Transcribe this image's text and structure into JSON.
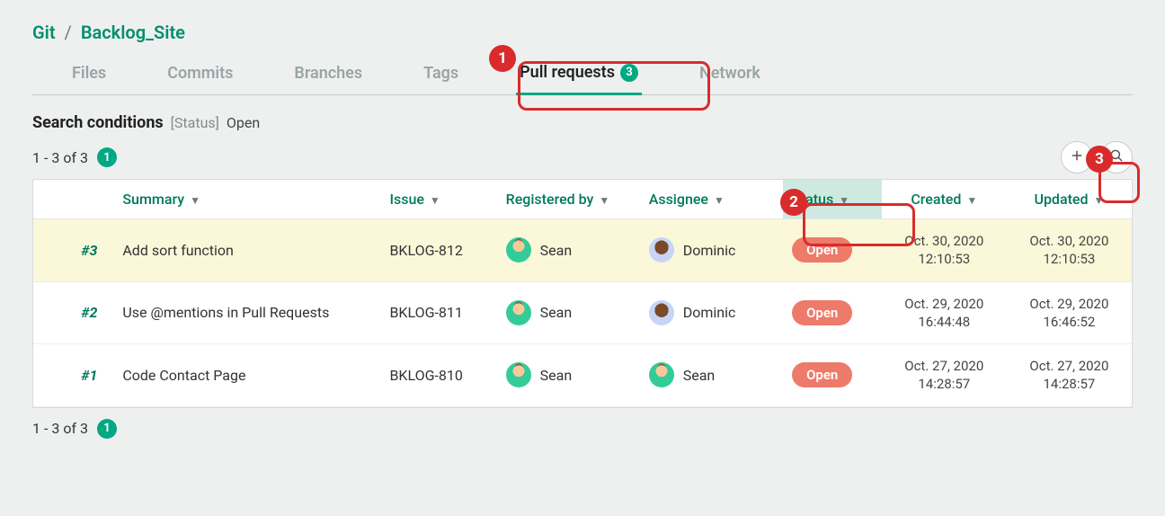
{
  "breadcrumb": {
    "root": "Git",
    "sep": "/",
    "repo": "Backlog_Site"
  },
  "tabs": {
    "files": "Files",
    "commits": "Commits",
    "branches": "Branches",
    "tags": "Tags",
    "pull_requests": "Pull requests",
    "pr_count": "3",
    "network": "Network"
  },
  "search": {
    "label": "Search conditions",
    "key": "[Status]",
    "value": "Open"
  },
  "range": {
    "text": "1 - 3 of 3",
    "count": "1"
  },
  "columns": {
    "summary": "Summary",
    "issue": "Issue",
    "registered_by": "Registered by",
    "assignee": "Assignee",
    "status": "Status",
    "created": "Created",
    "updated": "Updated"
  },
  "callouts": {
    "c1": "1",
    "c2": "2",
    "c3": "3"
  },
  "rows": [
    {
      "id": "#3",
      "summary": "Add sort function",
      "issue": "BKLOG-812",
      "registered_by": "Sean",
      "reg_avatar": "sean",
      "assignee": "Dominic",
      "asg_avatar": "dominic",
      "status": "Open",
      "created": "Oct. 30, 2020 12:10:53",
      "updated": "Oct. 30, 2020 12:10:53",
      "highlight": true
    },
    {
      "id": "#2",
      "summary": "Use @mentions in Pull Requests",
      "issue": "BKLOG-811",
      "registered_by": "Sean",
      "reg_avatar": "sean",
      "assignee": "Dominic",
      "asg_avatar": "dominic",
      "status": "Open",
      "created": "Oct. 29, 2020 16:44:48",
      "updated": "Oct. 29, 2020 16:46:52",
      "highlight": false
    },
    {
      "id": "#1",
      "summary": "Code Contact Page",
      "issue": "BKLOG-810",
      "registered_by": "Sean",
      "reg_avatar": "sean",
      "assignee": "Sean",
      "asg_avatar": "sean",
      "status": "Open",
      "created": "Oct. 27, 2020 14:28:57",
      "updated": "Oct. 27, 2020 14:28:57",
      "highlight": false
    }
  ]
}
